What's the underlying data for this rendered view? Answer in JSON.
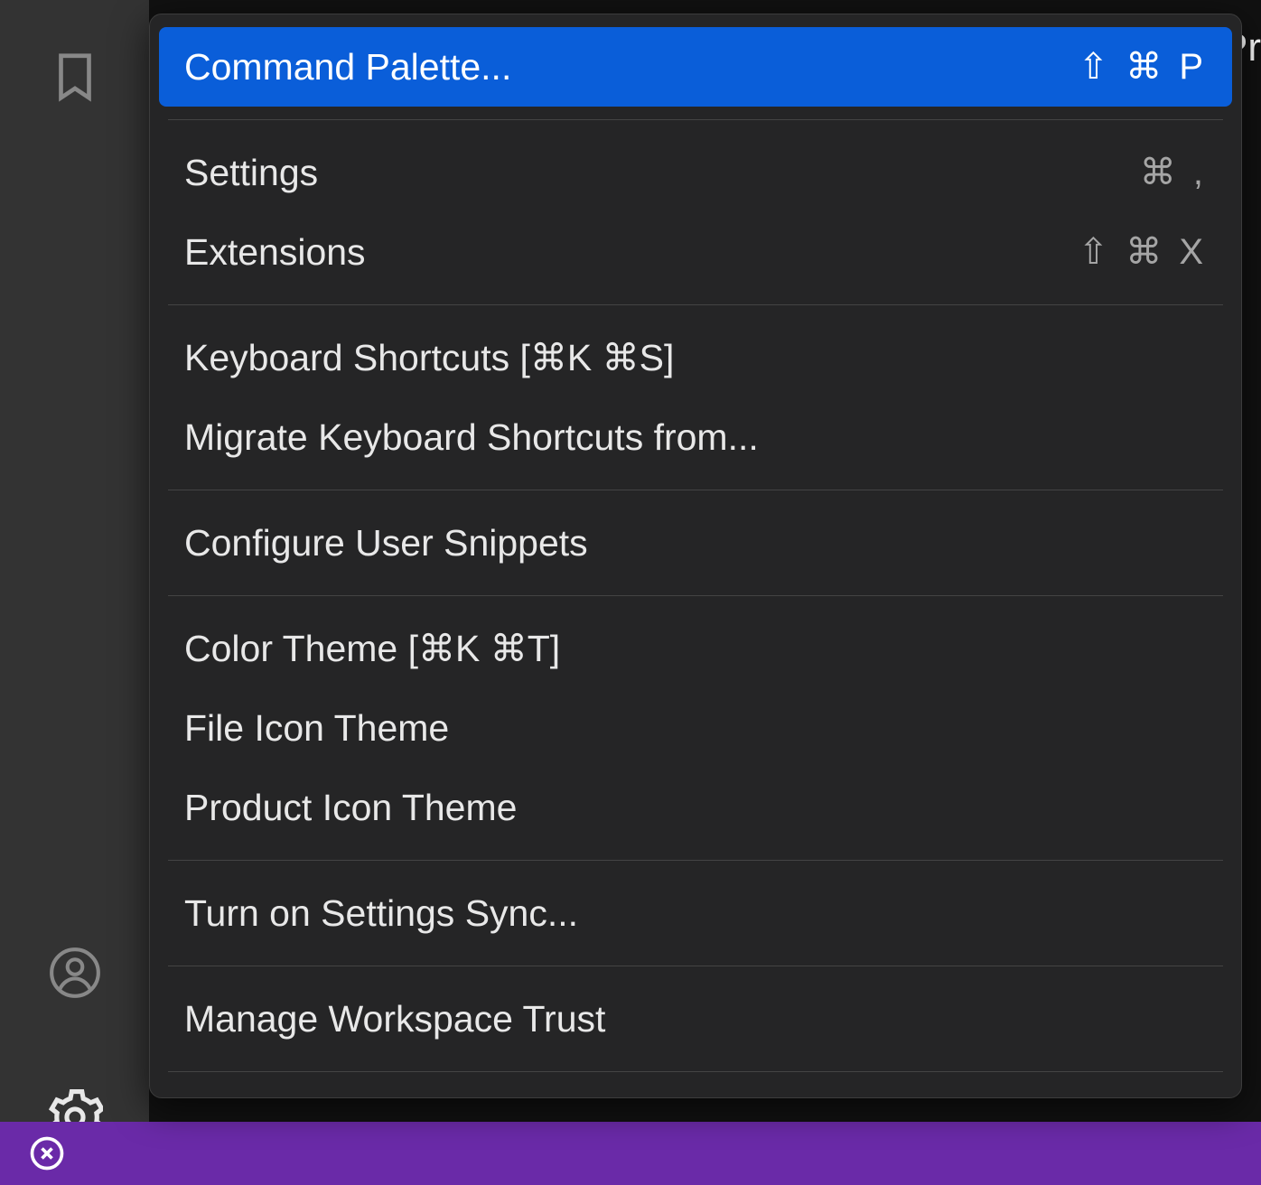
{
  "editor": {
    "cropped_text": "Pr"
  },
  "menu": {
    "items": [
      {
        "label": "Command Palette...",
        "shortcut": "⇧ ⌘ P",
        "highlighted": true
      },
      {
        "separator": true
      },
      {
        "label": "Settings",
        "shortcut": "⌘  ,"
      },
      {
        "label": "Extensions",
        "shortcut": "⇧ ⌘ X"
      },
      {
        "separator": true
      },
      {
        "label": "Keyboard Shortcuts [⌘K ⌘S]",
        "shortcut": ""
      },
      {
        "label": "Migrate Keyboard Shortcuts from...",
        "shortcut": ""
      },
      {
        "separator": true
      },
      {
        "label": "Configure User Snippets",
        "shortcut": ""
      },
      {
        "separator": true
      },
      {
        "label": "Color Theme [⌘K ⌘T]",
        "shortcut": ""
      },
      {
        "label": "File Icon Theme",
        "shortcut": ""
      },
      {
        "label": "Product Icon Theme",
        "shortcut": ""
      },
      {
        "separator": true
      },
      {
        "label": "Turn on Settings Sync...",
        "shortcut": ""
      },
      {
        "separator": true
      },
      {
        "label": "Manage Workspace Trust",
        "shortcut": ""
      },
      {
        "separator": true
      }
    ]
  },
  "colors": {
    "highlight": "#0a5ed9",
    "statusbar": "#6a2aa8"
  }
}
